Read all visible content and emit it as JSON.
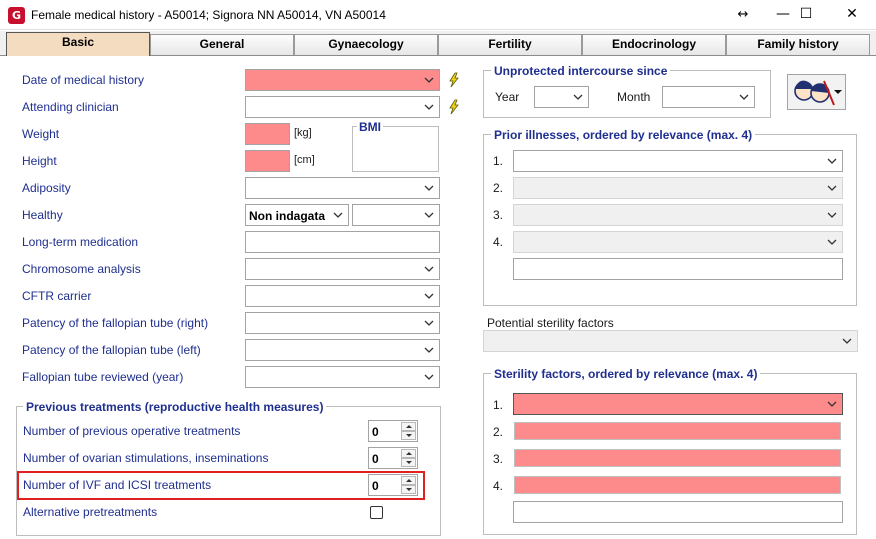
{
  "window": {
    "title": "Female medical history - A50014; Signora NN A50014, VN A50014",
    "logo_letter": "G",
    "move_glyph": "↔",
    "minimize_glyph": "—",
    "maximize_glyph": "☐",
    "close_glyph": "✕"
  },
  "tabs": [
    "Basic",
    "General",
    "Gynaecology",
    "Fertility",
    "Endocrinology",
    "Family history"
  ],
  "left_fields": {
    "date_of_medical_history": "Date of medical history",
    "attending_clinician": "Attending clinician",
    "weight": "Weight",
    "weight_unit": "[kg]",
    "height": "Height",
    "height_unit": "[cm]",
    "bmi": "BMI",
    "adiposity": "Adiposity",
    "healthy": "Healthy",
    "healthy_value": "Non indagata",
    "long_term_medication": "Long-term medication",
    "chromosome_analysis": "Chromosome analysis",
    "cftr_carrier": "CFTR carrier",
    "patency_right": "Patency of the fallopian tube (right)",
    "patency_left": "Patency of the fallopian tube (left)",
    "fallopian_reviewed": "Fallopian tube reviewed (year)"
  },
  "previous_treatments": {
    "title": "Previous treatments (reproductive health measures)",
    "operative": {
      "label": "Number of previous operative treatments",
      "value": "0"
    },
    "ovarian": {
      "label": "Number of ovarian stimulations, inseminations",
      "value": "0"
    },
    "ivf": {
      "label": "Number of IVF and ICSI treatments",
      "value": "0"
    },
    "alternative": {
      "label": "Alternative pretreatments"
    }
  },
  "unprotected": {
    "title": "Unprotected intercourse since",
    "year_label": "Year",
    "month_label": "Month"
  },
  "prior_illnesses": {
    "title": "Prior illnesses, ordered by relevance (max. 4)",
    "numbers": [
      "1.",
      "2.",
      "3.",
      "4."
    ]
  },
  "potential_sterility": {
    "label": "Potential sterility factors"
  },
  "sterility_factors": {
    "title": "Sterility factors, ordered by relevance (max. 4)",
    "numbers": [
      "1.",
      "2.",
      "3.",
      "4."
    ]
  },
  "colors": {
    "required_field": "#fe8b8b",
    "label_blue": "#1f2f8f",
    "active_tab": "#f4dcc0",
    "highlight_border": "#e02020"
  }
}
